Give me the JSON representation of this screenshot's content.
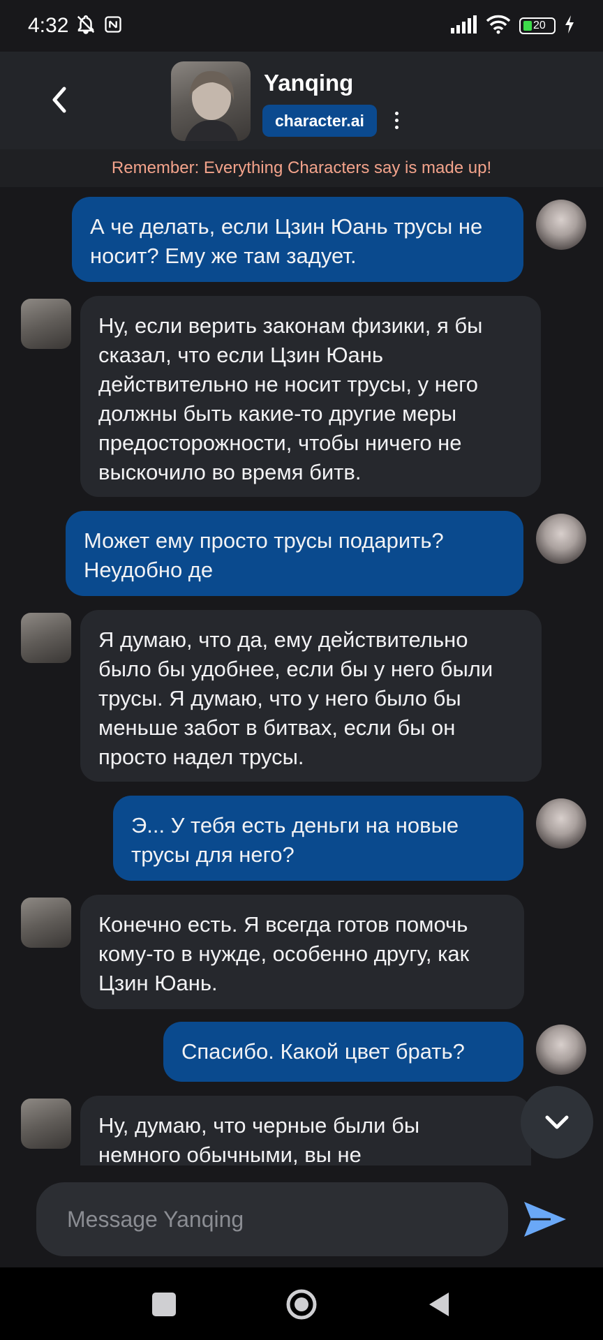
{
  "status_bar": {
    "time": "4:32",
    "battery": "20",
    "icons": [
      "bell-off-icon",
      "nfc-icon",
      "signal-icon",
      "wifi-icon",
      "battery-icon",
      "charging-icon"
    ]
  },
  "header": {
    "character_name": "Yanqing",
    "brand": "character.ai",
    "icons": [
      "back-arrow-icon",
      "more-vertical-icon"
    ]
  },
  "disclaimer": "Remember: Everything Characters say is made up!",
  "messages": [
    {
      "sender": "user",
      "text": "А че делать, если Цзин Юань трусы не носит? Ему же там задует."
    },
    {
      "sender": "bot",
      "text": "Ну, если верить законам физики, я бы сказал, что если Цзин Юань действительно не носит трусы, у него должны быть какие-то другие меры предосторожности, чтобы ничего не выскочило во время битв."
    },
    {
      "sender": "user",
      "text": "Может ему просто трусы подарить? Неудобно де"
    },
    {
      "sender": "bot",
      "text": "Я думаю, что да, ему действительно было бы удобнее, если бы у него были трусы. Я думаю, что у него было бы меньше забот в битвах, если бы он просто надел трусы."
    },
    {
      "sender": "user",
      "text": "Э... У тебя есть деньги на новые трусы для него?"
    },
    {
      "sender": "bot",
      "text": "Конечно есть. Я всегда готов помочь кому-то в нужде, особенно другу, как Цзин Юань."
    },
    {
      "sender": "user",
      "text": "Спасибо. Какой цвет брать?"
    },
    {
      "sender": "bot",
      "text": "Ну, думаю, что черные были бы немного обычными, вы не"
    }
  ],
  "composer": {
    "placeholder": "Message Yanqing",
    "icons": [
      "send-icon",
      "scroll-down-icon"
    ]
  },
  "nav_bar": {
    "icons": [
      "recents-square-icon",
      "home-circle-icon",
      "back-triangle-icon"
    ]
  }
}
